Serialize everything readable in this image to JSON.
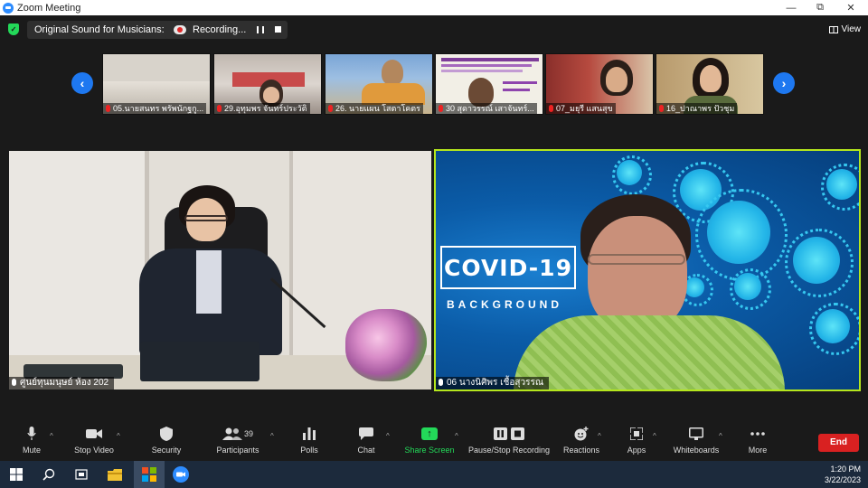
{
  "window": {
    "title": "Zoom Meeting",
    "minimize": "—",
    "maximize": "⧉",
    "close": "✕"
  },
  "topbar": {
    "security_status": "✓",
    "original_sound": "Original Sound for Musicians: Off",
    "recording_label": "Recording...",
    "view_label": "View"
  },
  "gallery": {
    "prev": "‹",
    "next": "›",
    "thumbnails": [
      {
        "name": "05.นายสนทร พรัพนักฐกู..."
      },
      {
        "name": "29.อุทุมพร จันทร์ประวัติ"
      },
      {
        "name": "26. นายแผน  โสตาโคตร"
      },
      {
        "name": "30 สุดาวรรณ์ เสาจันทร์..."
      },
      {
        "name": "07_มยุรี แสนสุข"
      },
      {
        "name": "16_ปาณาพร ปัวชุม"
      }
    ]
  },
  "main_tiles": {
    "left_name": "ศูนย์ทุนมนุษย์ ห้อง 202",
    "right_name": "06 นางนิศิพร เชื้อสุวรรณ",
    "covid_title": "COVID-19",
    "covid_subtitle": "BACKGROUND"
  },
  "toolbar": {
    "mute": "Mute",
    "stop_video": "Stop Video",
    "security": "Security",
    "participants": "Participants",
    "participants_count": "39",
    "polls": "Polls",
    "chat": "Chat",
    "share_screen": "Share Screen",
    "pause_stop_recording": "Pause/Stop Recording",
    "reactions": "Reactions",
    "apps": "Apps",
    "whiteboards": "Whiteboards",
    "more": "More",
    "end": "End"
  },
  "taskbar": {
    "time": "1:20 PM",
    "date": "3/22/2023"
  },
  "colors": {
    "accent": "#2d8cff",
    "share_green": "#23d959",
    "end_red": "#d92121",
    "speaker_border": "#b5e61d"
  }
}
